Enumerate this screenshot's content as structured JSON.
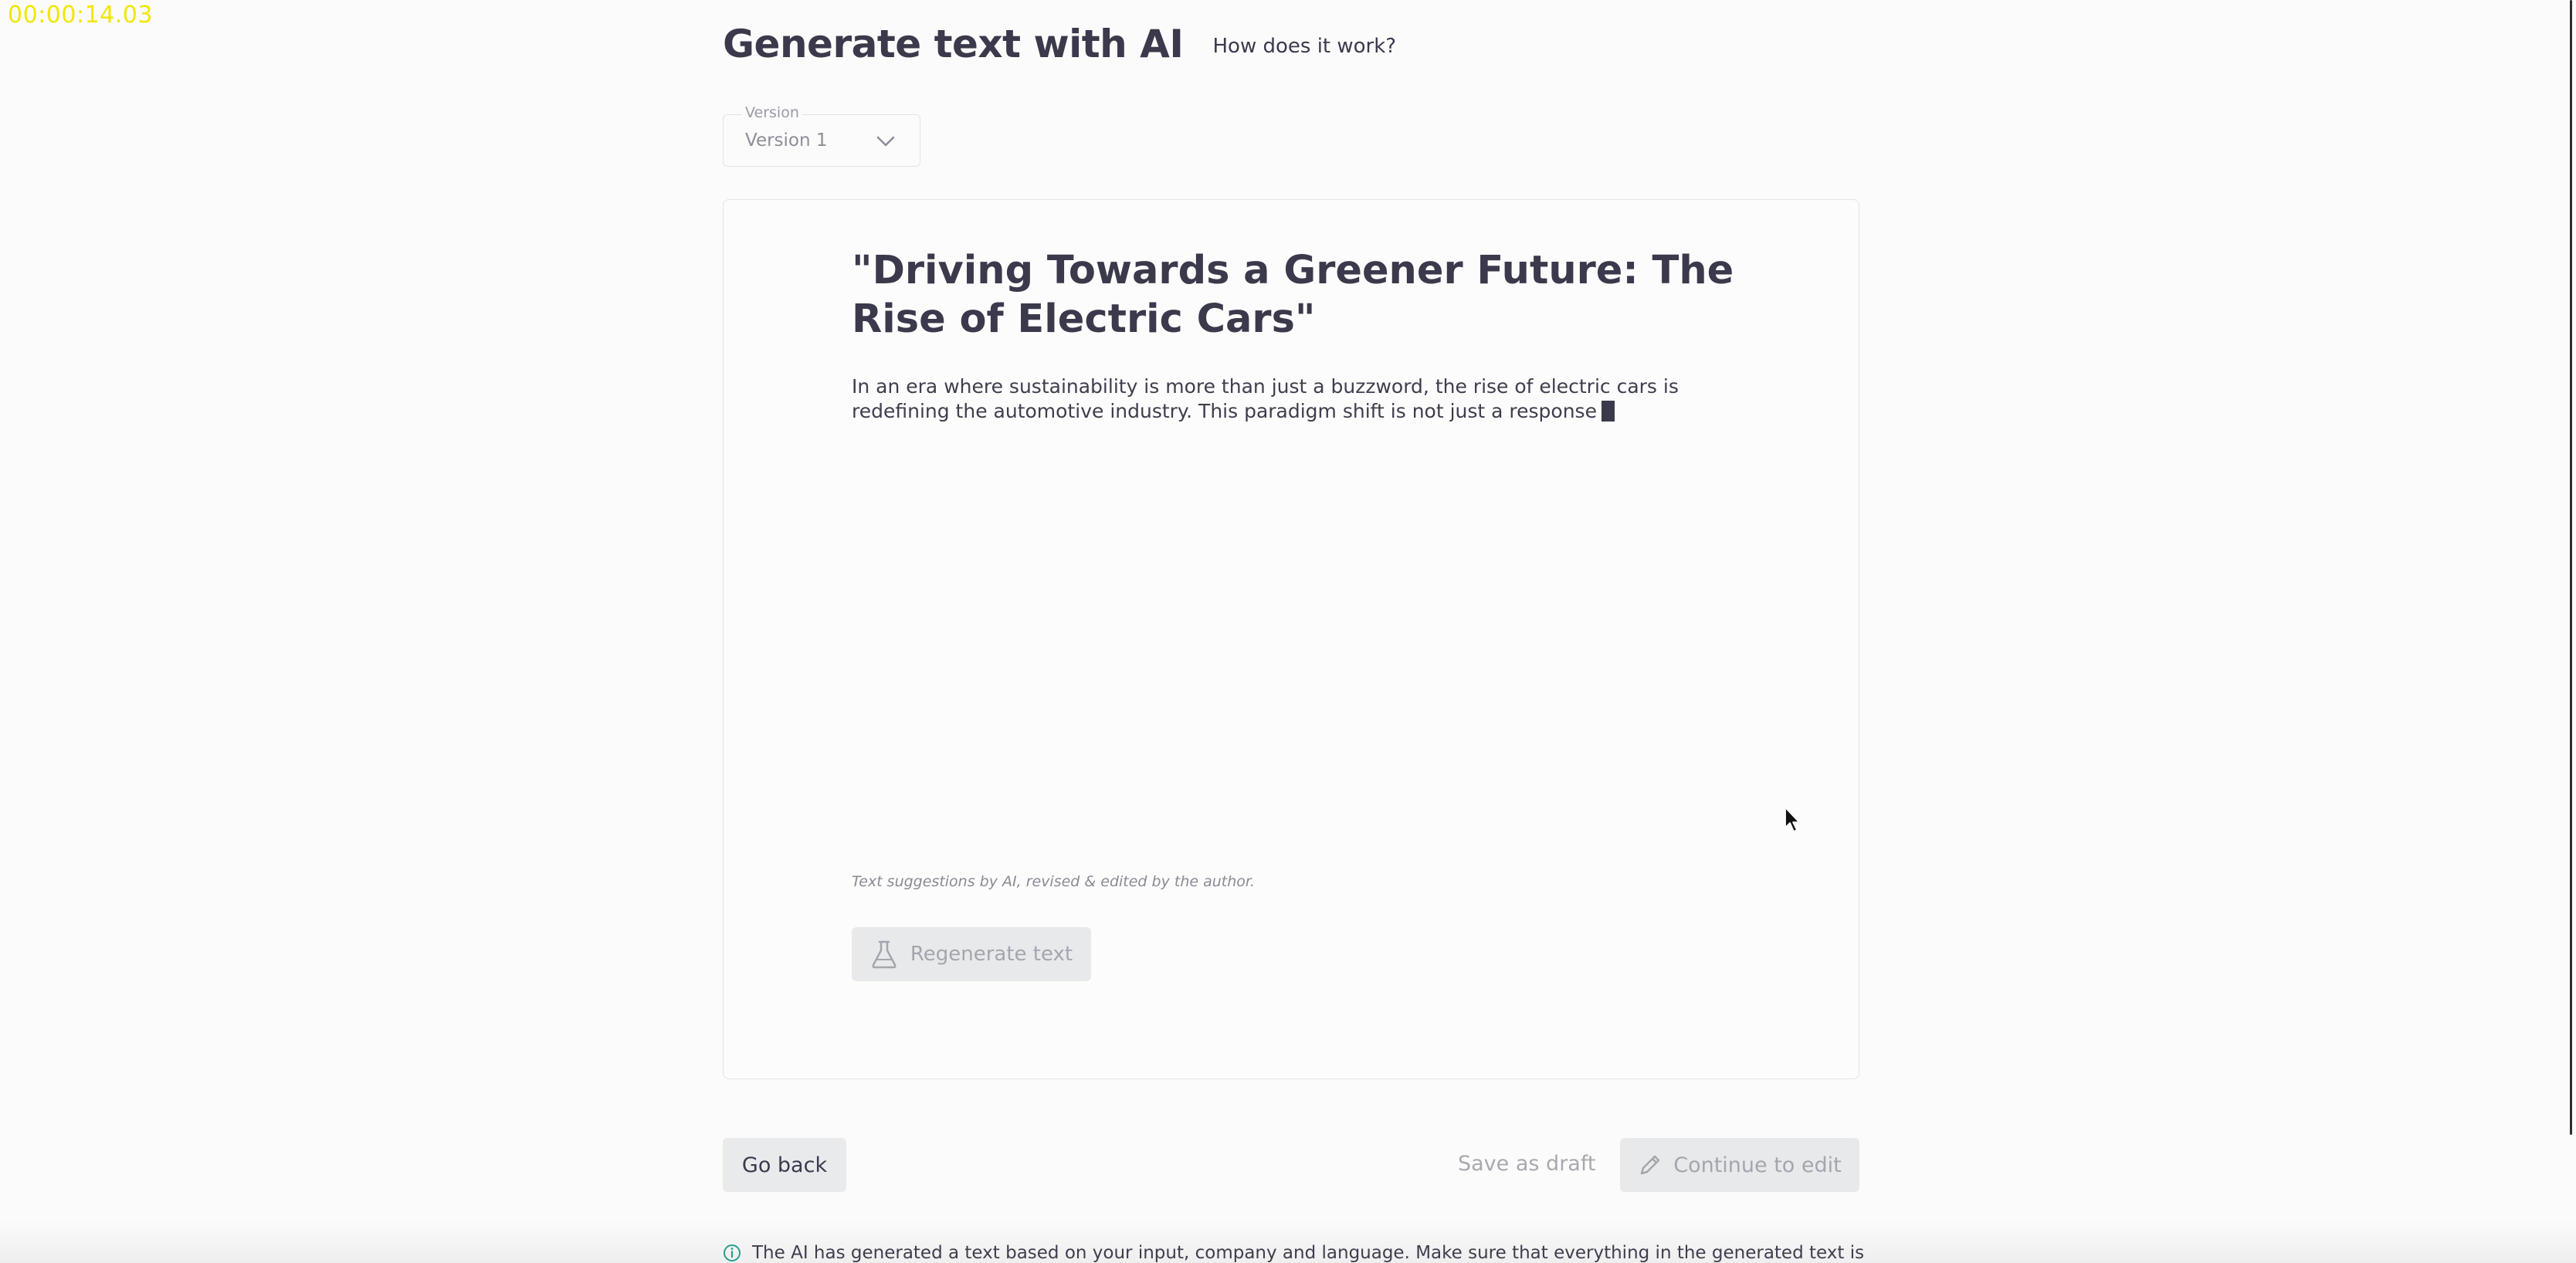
{
  "overlay": {
    "timer": "00:00:14.03"
  },
  "header": {
    "title": "Generate text with AI",
    "help_link": "How does it work?"
  },
  "version_select": {
    "label": "Version",
    "selected": "Version 1"
  },
  "article": {
    "title": "\"Driving Towards a Greener Future: The Rise of Electric Cars\"",
    "body": "In an era where sustainability is more than just a buzzword, the rise of electric cars is redefining the automotive industry. This paradigm shift is not just a response",
    "disclaimer": "Text suggestions by AI, revised & edited by the author.",
    "regenerate_label": "Regenerate text"
  },
  "footer": {
    "go_back_label": "Go back",
    "save_draft_label": "Save as draft",
    "continue_label": "Continue to edit",
    "info_text": "The AI has generated a text based on your input, company and language. Make sure that everything in the generated text is"
  },
  "icons": {
    "version_dropdown": "chevron-down-icon",
    "regenerate": "flask-icon",
    "continue": "pencil-icon",
    "info": "info-icon"
  },
  "colors": {
    "background": "#fbfbfb",
    "text": "#3b3a4c",
    "muted": "#a5a6ad",
    "disabled_button": "#e8e9eb",
    "timer": "#f2e700",
    "info_accent": "#2a9d8f"
  }
}
